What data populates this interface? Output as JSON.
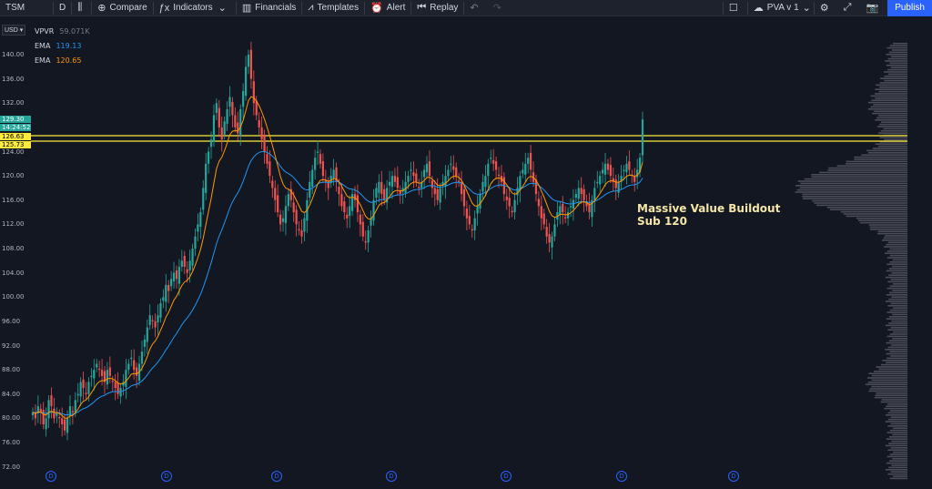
{
  "toolbar": {
    "symbol": "TSM",
    "interval": "D",
    "compare": "Compare",
    "indicators": "Indicators",
    "financials": "Financials",
    "templates": "Templates",
    "alert": "Alert",
    "replay": "Replay",
    "layout": "PVA v 1",
    "publish": "Publish"
  },
  "currency": "USD",
  "legend": {
    "vpvr_label": "VPVR",
    "vpvr_value": "59.071K",
    "ema1_label": "EMA",
    "ema1_value": "119.13",
    "ema2_label": "EMA",
    "ema2_value": "120.65"
  },
  "price_axis": [
    "140.00",
    "136.00",
    "132.00",
    "128.00",
    "124.00",
    "120.00",
    "116.00",
    "112.00",
    "108.00",
    "104.00",
    "100.00",
    "96.00",
    "92.00",
    "88.00",
    "84.00",
    "80.00",
    "76.00",
    "72.00"
  ],
  "price_tags": {
    "last": "129.30",
    "countdown": "14:24:52",
    "line1": "126.63",
    "line2": "125.73"
  },
  "annotation": {
    "line1": "Massive Value Buildout",
    "line2": "Sub 120"
  },
  "dividend_marker": "D",
  "colors": {
    "background": "#131722",
    "up": "#26a69a",
    "down": "#ef5350",
    "ema_fast": "#ff9800",
    "ema_slow": "#2196f3",
    "level_line": "#ffeb3b",
    "accent": "#2962ff"
  },
  "chart_data": {
    "type": "candlestick",
    "symbol": "TSM",
    "interval": "D",
    "ylim": [
      72,
      144
    ],
    "levels": [
      126.63,
      125.73
    ],
    "closes": [
      81,
      80,
      82,
      81,
      79,
      80,
      83,
      82,
      80,
      81,
      80,
      79,
      78,
      80,
      82,
      81,
      83,
      84,
      86,
      85,
      84,
      86,
      87,
      88,
      89,
      88,
      87,
      86,
      88,
      87,
      86,
      85,
      84,
      85,
      86,
      88,
      89,
      90,
      88,
      87,
      89,
      91,
      93,
      95,
      97,
      96,
      95,
      97,
      99,
      100,
      102,
      101,
      103,
      104,
      103,
      105,
      106,
      105,
      104,
      106,
      108,
      110,
      112,
      114,
      118,
      122,
      124,
      126,
      130,
      132,
      128,
      126,
      129,
      131,
      133,
      130,
      128,
      127,
      131,
      134,
      138,
      140,
      136,
      132,
      130,
      128,
      126,
      124,
      122,
      120,
      118,
      116,
      114,
      112,
      113,
      115,
      117,
      116,
      114,
      112,
      111,
      110,
      113,
      116,
      119,
      121,
      123,
      124,
      122,
      120,
      119,
      118,
      120,
      121,
      119,
      117,
      115,
      114,
      113,
      115,
      117,
      116,
      114,
      112,
      110,
      109,
      111,
      113,
      116,
      118,
      119,
      117,
      116,
      118,
      119,
      120,
      119,
      118,
      117,
      118,
      119,
      120,
      121,
      120,
      119,
      118,
      119,
      121,
      122,
      120,
      118,
      117,
      116,
      118,
      119,
      120,
      121,
      122,
      121,
      120,
      119,
      117,
      115,
      113,
      112,
      111,
      113,
      115,
      117,
      119,
      120,
      122,
      123,
      122,
      121,
      120,
      119,
      117,
      116,
      115,
      114,
      116,
      118,
      120,
      121,
      122,
      123,
      121,
      119,
      117,
      115,
      113,
      112,
      110,
      109,
      110,
      112,
      114,
      115,
      114,
      113,
      114,
      115,
      116,
      117,
      118,
      117,
      116,
      115,
      114,
      116,
      118,
      119,
      120,
      121,
      122,
      121,
      120,
      119,
      118,
      119,
      120,
      121,
      122,
      121,
      120,
      119,
      121,
      123,
      129.3
    ],
    "ema_fast_last": 120.65,
    "ema_slow_last": 119.13
  }
}
